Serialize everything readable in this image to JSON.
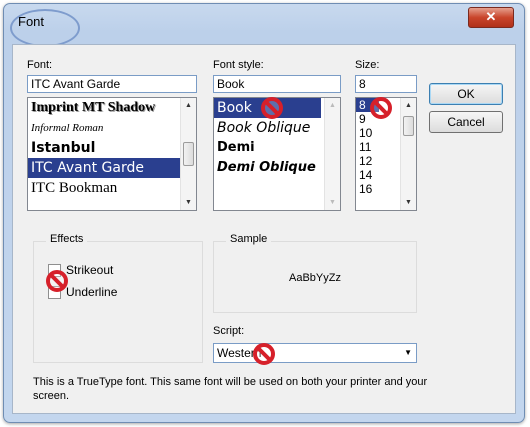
{
  "window": {
    "title": "Font",
    "close_glyph": "✕"
  },
  "font": {
    "label": "Font:",
    "value": "ITC Avant Garde",
    "items": [
      "Imprint MT Shadow",
      "Informal Roman",
      "Istanbul",
      "ITC Avant Garde",
      "ITC Bookman"
    ],
    "selected_index": 3
  },
  "style": {
    "label": "Font style:",
    "value": "Book",
    "items": [
      "Book",
      "Book Oblique",
      "Demi",
      "Demi Oblique"
    ],
    "selected_index": 0
  },
  "size": {
    "label": "Size:",
    "value": "8",
    "items": [
      "8",
      "9",
      "10",
      "11",
      "12",
      "14",
      "16"
    ],
    "selected_index": 0
  },
  "buttons": {
    "ok": "OK",
    "cancel": "Cancel"
  },
  "effects": {
    "title": "Effects",
    "strikeout": "Strikeout",
    "underline": "Underline"
  },
  "sample": {
    "title": "Sample",
    "text": "AaBbYyZz"
  },
  "script": {
    "label": "Script:",
    "value": "Western"
  },
  "info": "This is a TrueType font. This same font will be used on both your printer and your screen.",
  "colors": {
    "selection": "#2a3f8f",
    "prohibit": "#d6202a",
    "title_circle": "#7e9ccd"
  }
}
